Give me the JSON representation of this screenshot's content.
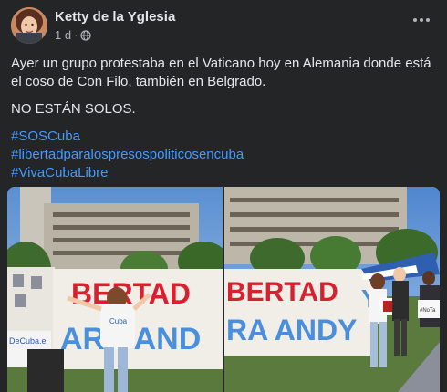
{
  "post": {
    "author": "Ketty de la Yglesia",
    "time": "1 d",
    "separator": "·",
    "paragraph1": "Ayer un grupo protestaba en el Vaticano hoy en Alemania donde está el coso de Con Filo, también en Belgrado.",
    "paragraph2": "NO ESTÁN SOLOS.",
    "hashtags": [
      "#SOSCuba",
      "#libertadparalospresospoliticosencuba",
      "#VivaCubaLibre"
    ]
  },
  "icons": {
    "privacy": "globe-icon",
    "menu": "more-options-icon"
  },
  "photos": {
    "photo1": {
      "banner_top": "BERTAD",
      "banner_bottom": "ARA AND",
      "side_sign": "DeCuba.e",
      "shirt_text": "Cuba"
    },
    "photo2": {
      "banner_top": "BERTAD",
      "banner_bottom": "RA ANDY",
      "sign_right": "Y",
      "small_sign": "#NoTa"
    }
  },
  "colors": {
    "background": "#242526",
    "text": "#e4e6eb",
    "secondary": "#b0b3b8",
    "link": "#4599ff",
    "banner_red": "#d8202f",
    "banner_blue": "#4a8fdc"
  }
}
